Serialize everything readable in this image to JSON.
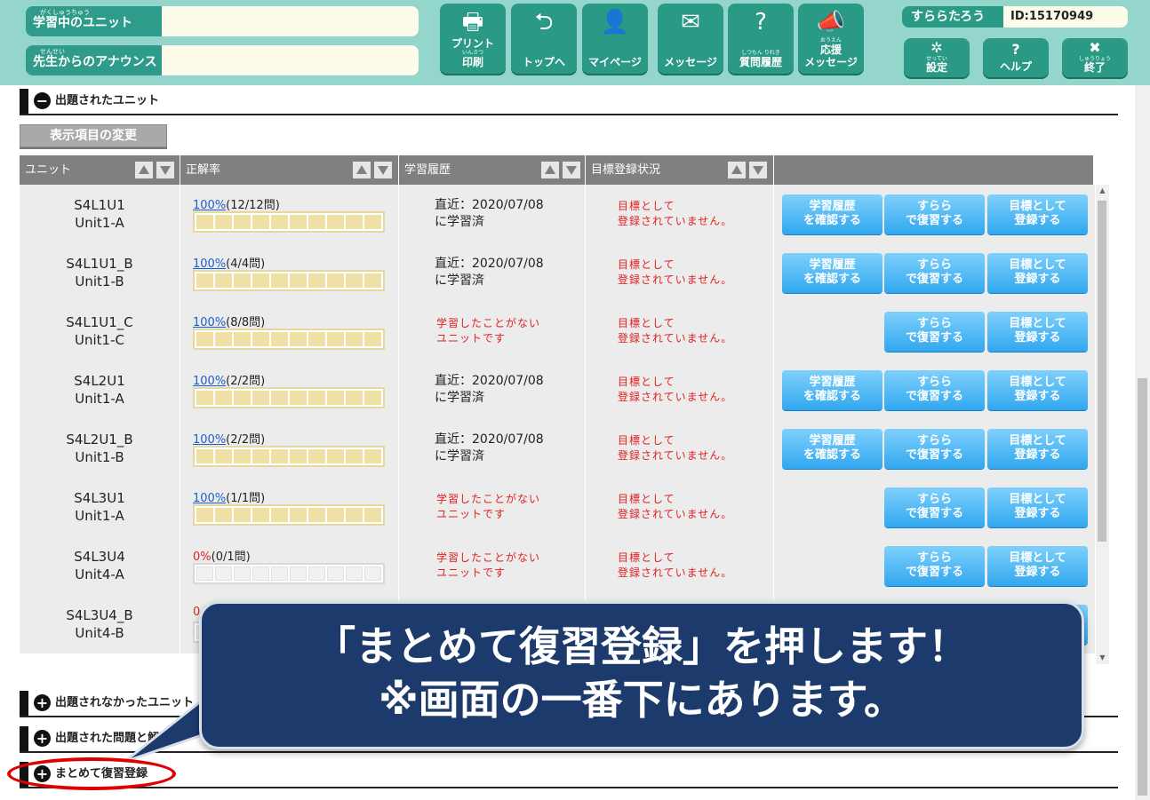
{
  "header": {
    "study_unit": {
      "ruby": "がくしゅうちゅう",
      "label": "学習中のユニット",
      "value": ""
    },
    "announce": {
      "ruby": "せんせい",
      "label": "先生からのアナウンス",
      "value": ""
    },
    "nav": [
      {
        "icon": "printer-icon",
        "glyph": "🖶",
        "ruby": "",
        "label": "プリント",
        "sub": "いんさつ",
        "label2": "印刷"
      },
      {
        "icon": "return-icon",
        "glyph": "⮌",
        "ruby": "",
        "label": "トップへ",
        "sub": "",
        "label2": ""
      },
      {
        "icon": "person-icon",
        "glyph": "👤",
        "ruby": "",
        "label": "マイページ",
        "sub": "",
        "label2": ""
      },
      {
        "icon": "envelope-icon",
        "glyph": "✉",
        "ruby": "",
        "label": "メッセージ",
        "sub": "",
        "label2": ""
      },
      {
        "icon": "question-chat-icon",
        "glyph": "?",
        "ruby": "しつもん りれき",
        "label": "質問履歴",
        "sub": "",
        "label2": ""
      },
      {
        "icon": "megaphone-icon",
        "glyph": "📣",
        "ruby": "おうえん",
        "label": "応援",
        "sub": "",
        "label2": "メッセージ"
      }
    ],
    "user_name": "すららたろう",
    "user_id": "ID:15170949",
    "settings": {
      "glyph": "✲",
      "sub": "せってい",
      "label": "設定"
    },
    "help": {
      "glyph": "?",
      "label": "ヘルプ"
    },
    "quit": {
      "glyph": "✖",
      "sub": "しゅうりょう",
      "label": "終了"
    }
  },
  "sections": {
    "assigned": "出題されたユニット",
    "not_assigned": "出題されなかったユニット",
    "qa": "出題された問題と解答",
    "bulk": "まとめて復習登録",
    "toggle_minus": "−",
    "toggle_plus": "+"
  },
  "change_button": "表示項目の変更",
  "table": {
    "headers": [
      "ユニット",
      "正解率",
      "学習履歴",
      "目標登録状況"
    ],
    "rows": [
      {
        "unit": [
          "S4L1U1",
          "Unit1-A"
        ],
        "pct": "100%",
        "count": "(12/12問)",
        "fill": 1.0,
        "history": [
          "直近：2020/07/08",
          "に学習済"
        ],
        "studied": true
      },
      {
        "unit": [
          "S4L1U1_B",
          "Unit1-B"
        ],
        "pct": "100%",
        "count": "(4/4問)",
        "fill": 1.0,
        "history": [
          "直近：2020/07/08",
          "に学習済"
        ],
        "studied": true
      },
      {
        "unit": [
          "S4L1U1_C",
          "Unit1-C"
        ],
        "pct": "100%",
        "count": "(8/8問)",
        "fill": 1.0,
        "history": [
          "学習したことがない",
          "ユニットです"
        ],
        "studied": false
      },
      {
        "unit": [
          "S4L2U1",
          "Unit1-A"
        ],
        "pct": "100%",
        "count": "(2/2問)",
        "fill": 1.0,
        "history": [
          "直近：2020/07/08",
          "に学習済"
        ],
        "studied": true
      },
      {
        "unit": [
          "S4L2U1_B",
          "Unit1-B"
        ],
        "pct": "100%",
        "count": "(2/2問)",
        "fill": 1.0,
        "history": [
          "直近：2020/07/08",
          "に学習済"
        ],
        "studied": true
      },
      {
        "unit": [
          "S4L3U1",
          "Unit1-A"
        ],
        "pct": "100%",
        "count": "(1/1問)",
        "fill": 1.0,
        "history": [
          "学習したことがない",
          "ユニットです"
        ],
        "studied": false
      },
      {
        "unit": [
          "S4L3U4",
          "Unit4-A"
        ],
        "pct": "0%",
        "count": "(0/1問)",
        "fill": 0.0,
        "history": [
          "学習したことがない",
          "ユニットです"
        ],
        "studied": false
      },
      {
        "unit": [
          "S4L3U4_B",
          "Unit4-B"
        ],
        "pct": "0",
        "count": "",
        "fill": 0.0,
        "history": [
          "",
          ""
        ],
        "studied": false
      }
    ],
    "goal_status": [
      "目標として",
      "登録されていません。"
    ],
    "btn_history": [
      "学習履歴",
      "を確認する"
    ],
    "btn_review": [
      "すらら",
      "で復習する"
    ],
    "btn_goal": [
      "目標として",
      "登録する"
    ]
  },
  "callout": {
    "line1": "「まとめて復習登録」を押します！",
    "line2": "※画面の一番下にあります。"
  },
  "colors": {
    "header_bg": "#94d6cc",
    "nav_teal": "#2a9a86",
    "button_blue": "#31a7ef",
    "callout_bg": "#1c3a6b",
    "highlight_red": "#e00000",
    "warning_red": "#e02020"
  }
}
